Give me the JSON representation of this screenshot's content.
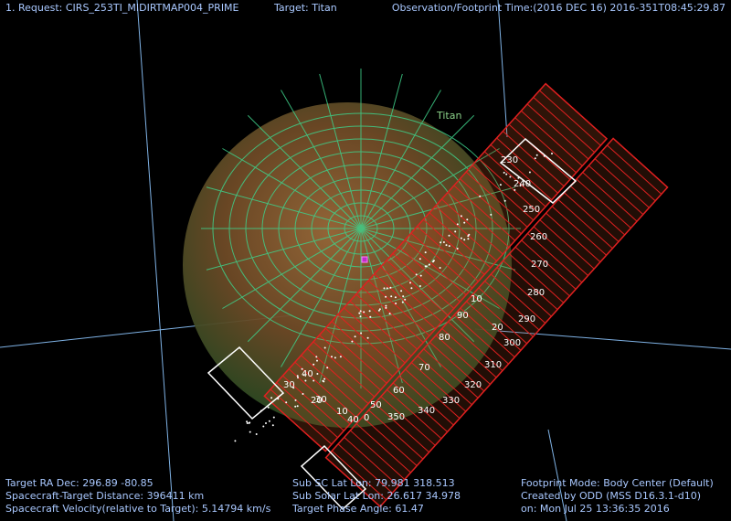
{
  "header": {
    "request": "1. Request: CIRS_253TI_MIDIRTMAP004_PRIME",
    "target": "Target: Titan",
    "time": "Observation/Footprint Time:(2016 DEC 16) 2016-351T08:45:29.87"
  },
  "body_label": "Titan",
  "colors": {
    "background": "#000000",
    "grid_lines": "#7fb2e5",
    "planet_grid": "#3fd08a",
    "footprint": "#e02020",
    "outline": "#ffffff",
    "text": "#a9c8ff"
  },
  "footprint_labels": [
    "230",
    "240",
    "250",
    "260",
    "270",
    "280",
    "290",
    "300",
    "310",
    "320",
    "330",
    "340",
    "350",
    "0",
    "10",
    "20",
    "30",
    "40",
    "50",
    "60",
    "70",
    "80",
    "90",
    "10",
    "20",
    "30",
    "40"
  ],
  "info_left": {
    "ra_dec": "Target RA Dec: 296.89  -80.85",
    "distance": "Spacecraft-Target Distance:  396411 km",
    "velocity": "Spacecraft Velocity(relative to Target): 5.14794 km/s"
  },
  "info_mid": {
    "sub_sc": "Sub SC Lat Lon: 79.981  318.513",
    "sub_solar": "Sub Solar Lat Lon: 26.617  34.978",
    "phase": "Target Phase Angle: 61.47"
  },
  "info_right": {
    "mode": "Footprint Mode: Body Center (Default)",
    "created": "Created by ODD (MSS D16.3.1-d10)",
    "on": "on: Mon Jul 25 13:36:35 2016"
  }
}
